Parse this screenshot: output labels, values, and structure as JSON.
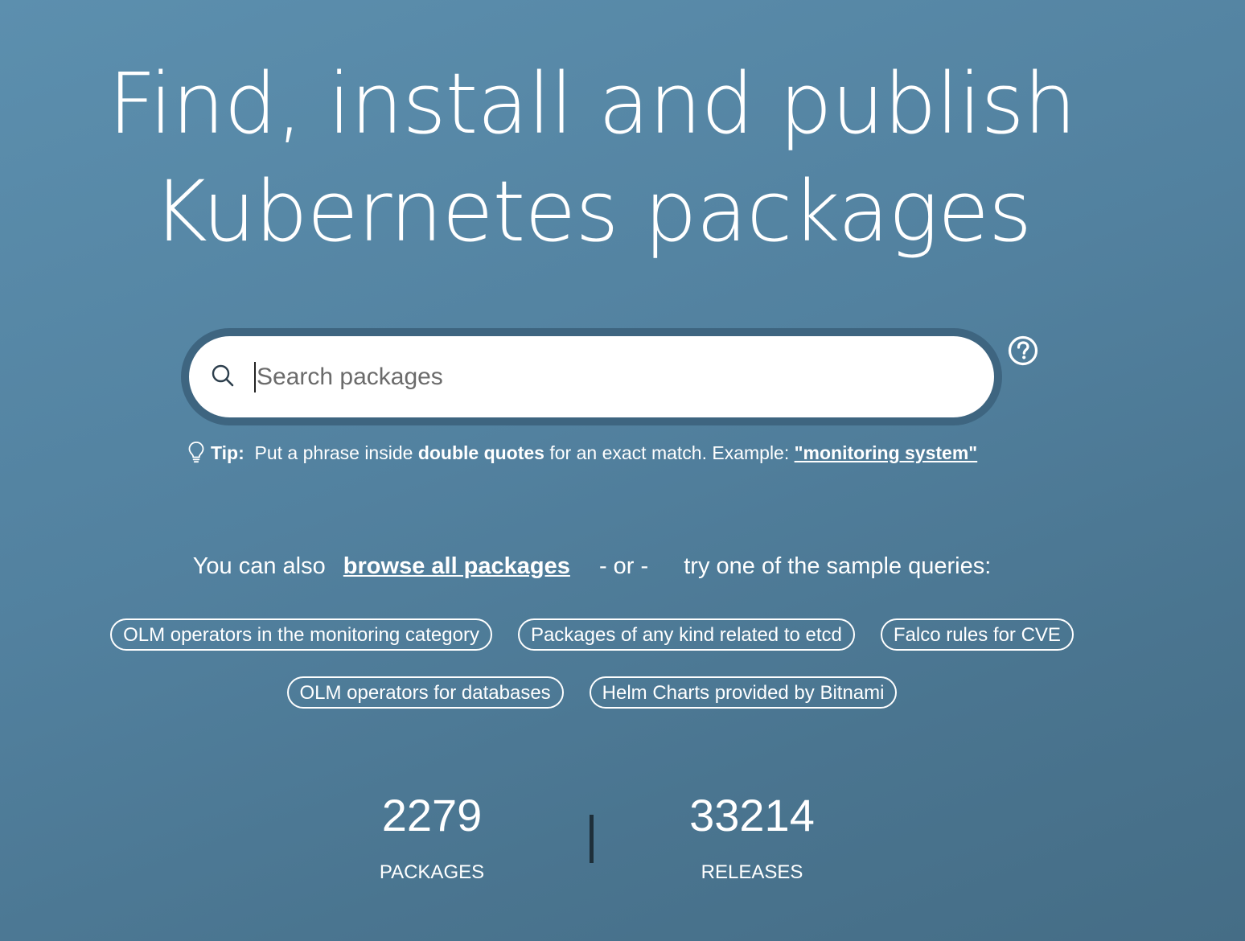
{
  "hero": {
    "title_line1": "Find, install and publish",
    "title_line2": "Kubernetes packages"
  },
  "search": {
    "placeholder": "Search packages",
    "icon": "search-icon",
    "help_icon": "question-circle-icon"
  },
  "tip": {
    "icon": "lightbulb-icon",
    "label": "Tip:",
    "text_before": "Put a phrase inside",
    "bold_text": "double quotes",
    "text_after": "for an exact match. Example:",
    "example_link": "\"monitoring system\""
  },
  "browse": {
    "prefix": "You can also",
    "link": "browse all packages",
    "or": "- or -",
    "suffix": "try one of the sample queries:"
  },
  "sample_queries": [
    "OLM operators in the monitoring category",
    "Packages of any kind related to etcd",
    "Falco rules for CVE",
    "OLM operators for databases",
    "Helm Charts provided by Bitnami"
  ],
  "stats": {
    "packages_count": "2279",
    "packages_label": "PACKAGES",
    "releases_count": "33214",
    "releases_label": "RELEASES"
  },
  "colors": {
    "background_start": "#5c8fae",
    "background_end": "#456d86",
    "search_border": "#3e6580",
    "text": "#ffffff"
  }
}
